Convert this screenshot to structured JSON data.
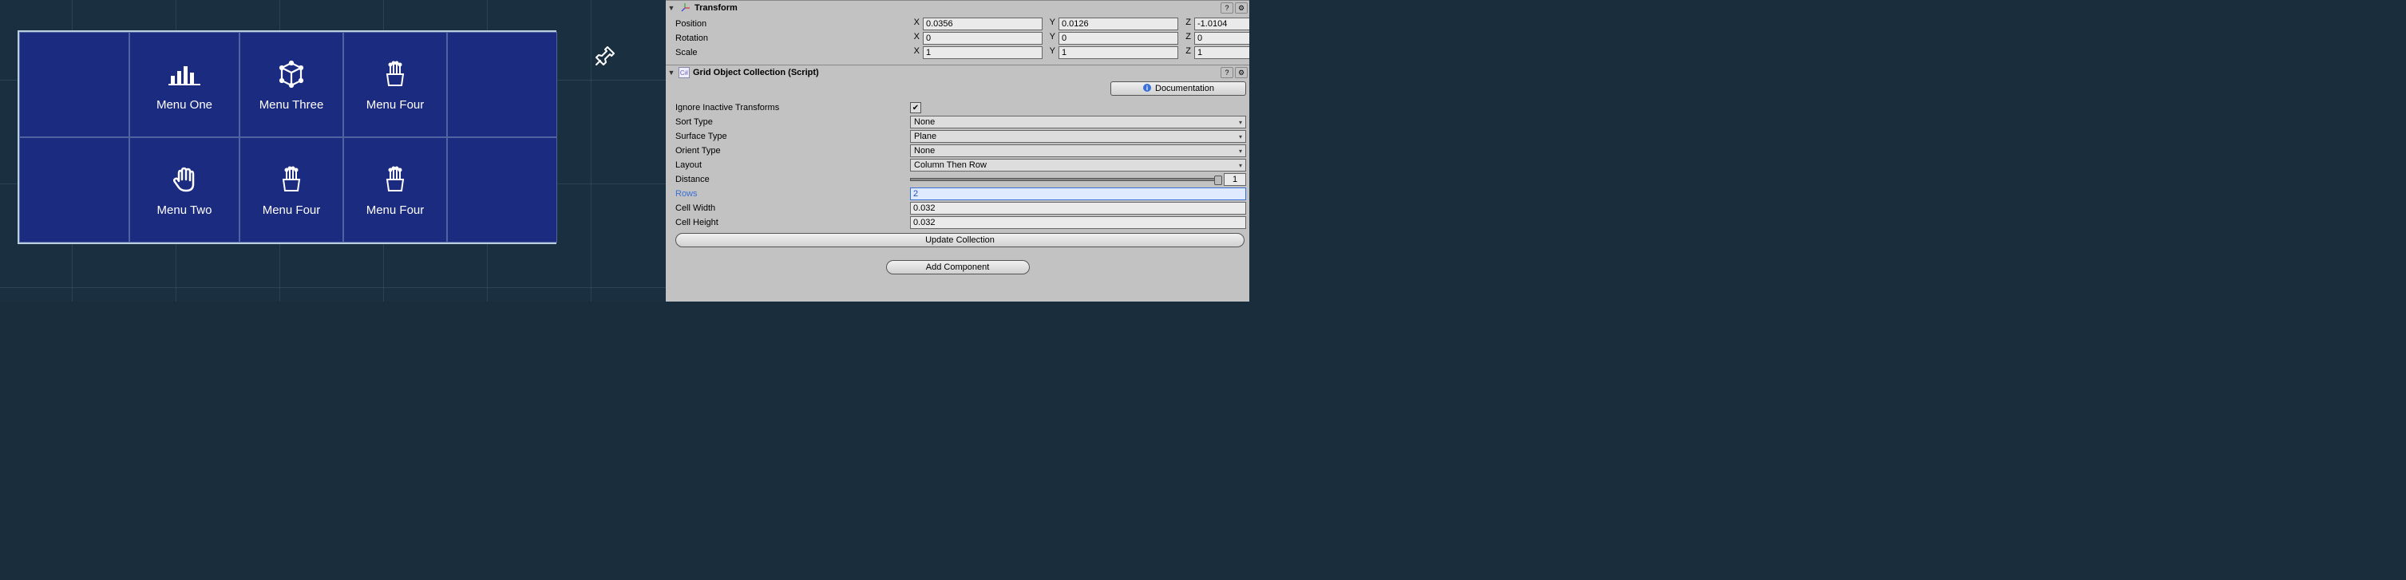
{
  "viewport": {
    "menu": {
      "one": "Menu One",
      "two": "Menu Two",
      "three": "Menu Three",
      "four_a": "Menu Four",
      "four_b": "Menu Four",
      "four_c": "Menu Four"
    }
  },
  "inspector": {
    "transform": {
      "title": "Transform",
      "position": {
        "label": "Position",
        "x": "0.0356",
        "y": "0.0126",
        "z": "-1.0104"
      },
      "rotation": {
        "label": "Rotation",
        "x": "0",
        "y": "0",
        "z": "0"
      },
      "scale": {
        "label": "Scale",
        "x": "1",
        "y": "1",
        "z": "1"
      },
      "axis": {
        "x": "X",
        "y": "Y",
        "z": "Z"
      }
    },
    "grid": {
      "title": "Grid Object Collection (Script)",
      "doc_button": "Documentation",
      "ignore_label": "Ignore Inactive Transforms",
      "ignore_value": true,
      "sort_label": "Sort Type",
      "sort_value": "None",
      "surface_label": "Surface Type",
      "surface_value": "Plane",
      "orient_label": "Orient Type",
      "orient_value": "None",
      "layout_label": "Layout",
      "layout_value": "Column Then Row",
      "distance_label": "Distance",
      "distance_value": "1",
      "rows_label": "Rows",
      "rows_value": "2",
      "cellw_label": "Cell Width",
      "cellw_value": "0.032",
      "cellh_label": "Cell Height",
      "cellh_value": "0.032",
      "update_button": "Update Collection"
    },
    "add_component": "Add Component"
  }
}
